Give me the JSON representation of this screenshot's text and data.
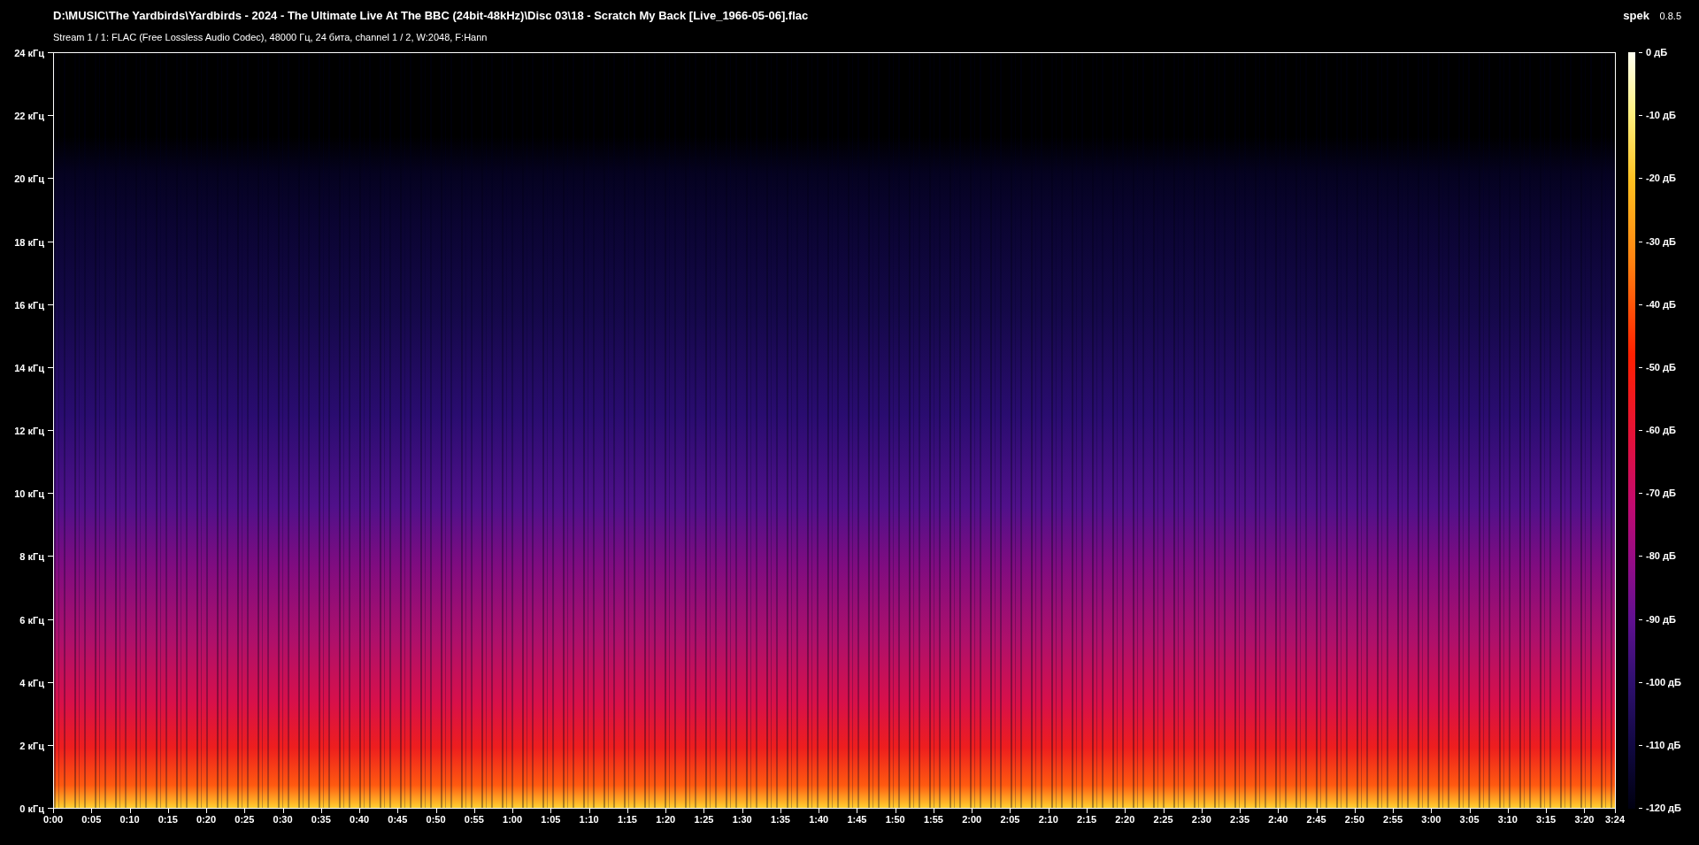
{
  "header": {
    "file_path": "D:\\MUSIC\\The Yardbirds\\Yardbirds - 2024 - The Ultimate Live At The BBC (24bit-48kHz)\\Disc 03\\18 - Scratch My Back [Live_1966-05-06].flac",
    "stream_info": "Stream 1 / 1: FLAC (Free Lossless Audio Codec), 48000 Гц, 24 бита, channel 1 / 2, W:2048, F:Hann",
    "app_name": "spek",
    "app_version": "0.8.5"
  },
  "frequency_axis": [
    "24 кГц",
    "22 кГц",
    "20 кГц",
    "18 кГц",
    "16 кГц",
    "14 кГц",
    "12 кГц",
    "10 кГц",
    "8 кГц",
    "6 кГц",
    "4 кГц",
    "2 кГц",
    "0 кГц"
  ],
  "time_axis": [
    "0:00",
    "0:05",
    "0:10",
    "0:15",
    "0:20",
    "0:25",
    "0:30",
    "0:35",
    "0:40",
    "0:45",
    "0:50",
    "0:55",
    "1:00",
    "1:05",
    "1:10",
    "1:15",
    "1:20",
    "1:25",
    "1:30",
    "1:35",
    "1:40",
    "1:45",
    "1:50",
    "1:55",
    "2:00",
    "2:05",
    "2:10",
    "2:15",
    "2:20",
    "2:25",
    "2:30",
    "2:35",
    "2:40",
    "2:45",
    "2:50",
    "2:55",
    "3:00",
    "3:05",
    "3:10",
    "3:15",
    "3:20",
    "3:24"
  ],
  "db_scale": [
    "0 дБ",
    "-10 дБ",
    "-20 дБ",
    "-30 дБ",
    "-40 дБ",
    "-50 дБ",
    "-60 дБ",
    "-70 дБ",
    "-80 дБ",
    "-90 дБ",
    "-100 дБ",
    "-110 дБ",
    "-120 дБ"
  ]
}
